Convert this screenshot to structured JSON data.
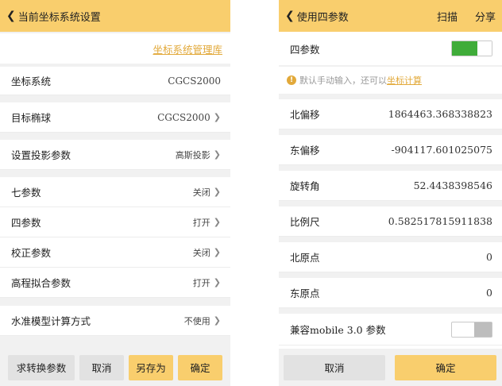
{
  "left": {
    "header": {
      "title": "当前坐标系统设置"
    },
    "link": "坐标系统管理库",
    "rows": [
      {
        "label": "坐标系统",
        "value": "CGCS2000"
      },
      {
        "label": "目标椭球",
        "value": "CGCS2000"
      },
      {
        "label": "设置投影参数",
        "value": "高斯投影"
      },
      {
        "label": "七参数",
        "value": "关闭"
      },
      {
        "label": "四参数",
        "value": "打开"
      },
      {
        "label": "校正参数",
        "value": "关闭"
      },
      {
        "label": "高程拟合参数",
        "value": "打开"
      },
      {
        "label": "水准模型计算方式",
        "value": "不使用"
      }
    ],
    "buttons": {
      "convert": "求转换参数",
      "cancel": "取消",
      "saveas": "另存为",
      "confirm": "确定"
    }
  },
  "right": {
    "header": {
      "title": "使用四参数",
      "scan": "扫描",
      "share": "分享"
    },
    "toggle_label": "四参数",
    "toggle_on": true,
    "hint_text": "默认手动输入，还可以",
    "hint_link": "坐标计算",
    "rows": [
      {
        "label": "北偏移",
        "value": "1864463.368338823"
      },
      {
        "label": "东偏移",
        "value": "-904117.601025075"
      },
      {
        "label": "旋转角",
        "value": "52.4438398546"
      },
      {
        "label": "比例尺",
        "value": "0.582517815911838"
      },
      {
        "label": "北原点",
        "value": "0"
      },
      {
        "label": "东原点",
        "value": "0"
      }
    ],
    "compat_label": "兼容mobile 3.0 参数",
    "compat_on": false,
    "buttons": {
      "cancel": "取消",
      "confirm": "确定"
    }
  },
  "colors": {
    "accent": "#f9ce6d",
    "link": "#e2a93a",
    "toggle_on": "#3fac39",
    "gap": "#f1f1f1"
  },
  "icons": {
    "back": "chevron-left-icon",
    "row_arrow": "chevron-right-icon",
    "hint": "info-icon"
  }
}
